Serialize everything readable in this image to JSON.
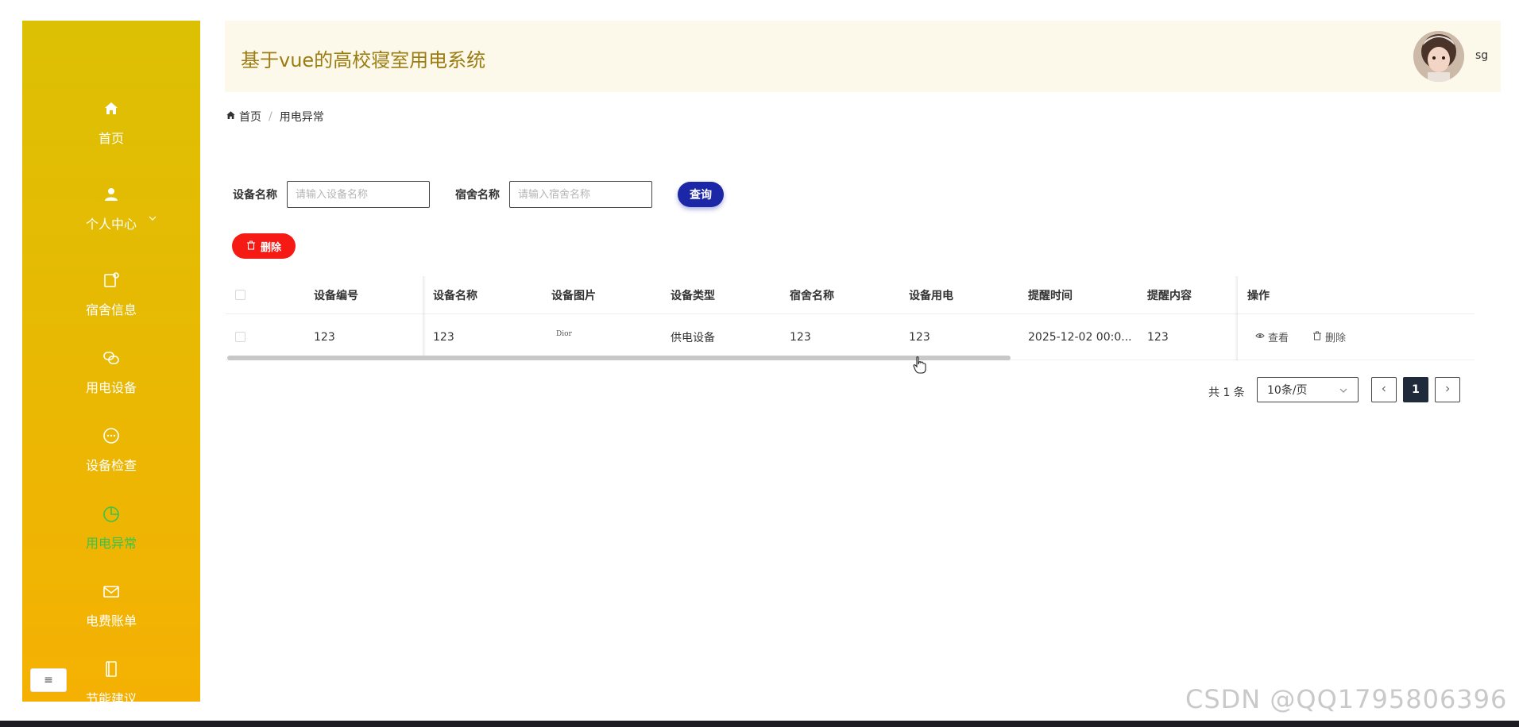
{
  "app": {
    "title": "基于vue的高校寝室用电系统",
    "username": "sg"
  },
  "sidebar": {
    "items": [
      {
        "label": "首页",
        "icon": "home-icon"
      },
      {
        "label": "个人中心",
        "icon": "user-icon"
      },
      {
        "label": "宿舍信息",
        "icon": "document-icon"
      },
      {
        "label": "用电设备",
        "icon": "link-icon"
      },
      {
        "label": "设备检查",
        "icon": "chat-icon"
      },
      {
        "label": "用电异常",
        "icon": "pie-chart-icon"
      },
      {
        "label": "电费账单",
        "icon": "mail-icon"
      },
      {
        "label": "节能建议",
        "icon": "notebook-icon"
      }
    ],
    "active_index": 5,
    "active_color": "#39c34b",
    "collapse_symbol": "≡"
  },
  "breadcrumb": {
    "home": "首页",
    "separator": "/",
    "current": "用电异常"
  },
  "search": {
    "device_label": "设备名称",
    "device_placeholder": "请输入设备名称",
    "dorm_label": "宿舍名称",
    "dorm_placeholder": "请输入宿舍名称",
    "query_label": "查询"
  },
  "toolbar": {
    "delete_label": "删除"
  },
  "table": {
    "columns": [
      "设备编号",
      "设备名称",
      "设备图片",
      "设备类型",
      "宿舍名称",
      "设备用电",
      "提醒时间",
      "提醒内容",
      "操作"
    ],
    "rows": [
      {
        "code": "123",
        "name": "123",
        "image_text": "Dior",
        "type": "供电设备",
        "dorm": "123",
        "power": "123",
        "remind_time": "2025-12-02 00:0...",
        "remind_content": "123",
        "view_label": "查看",
        "delete_label": "删除"
      }
    ]
  },
  "pagination": {
    "total": "共 1 条",
    "page_size": "10条/页",
    "current_page": "1"
  },
  "watermark": "CSDN @QQ1795806396",
  "colors": {
    "sidebar_top": "#dcc003",
    "sidebar_bottom": "#f5b103",
    "query_button": "#1c27a8",
    "delete_button": "#f51a14"
  }
}
